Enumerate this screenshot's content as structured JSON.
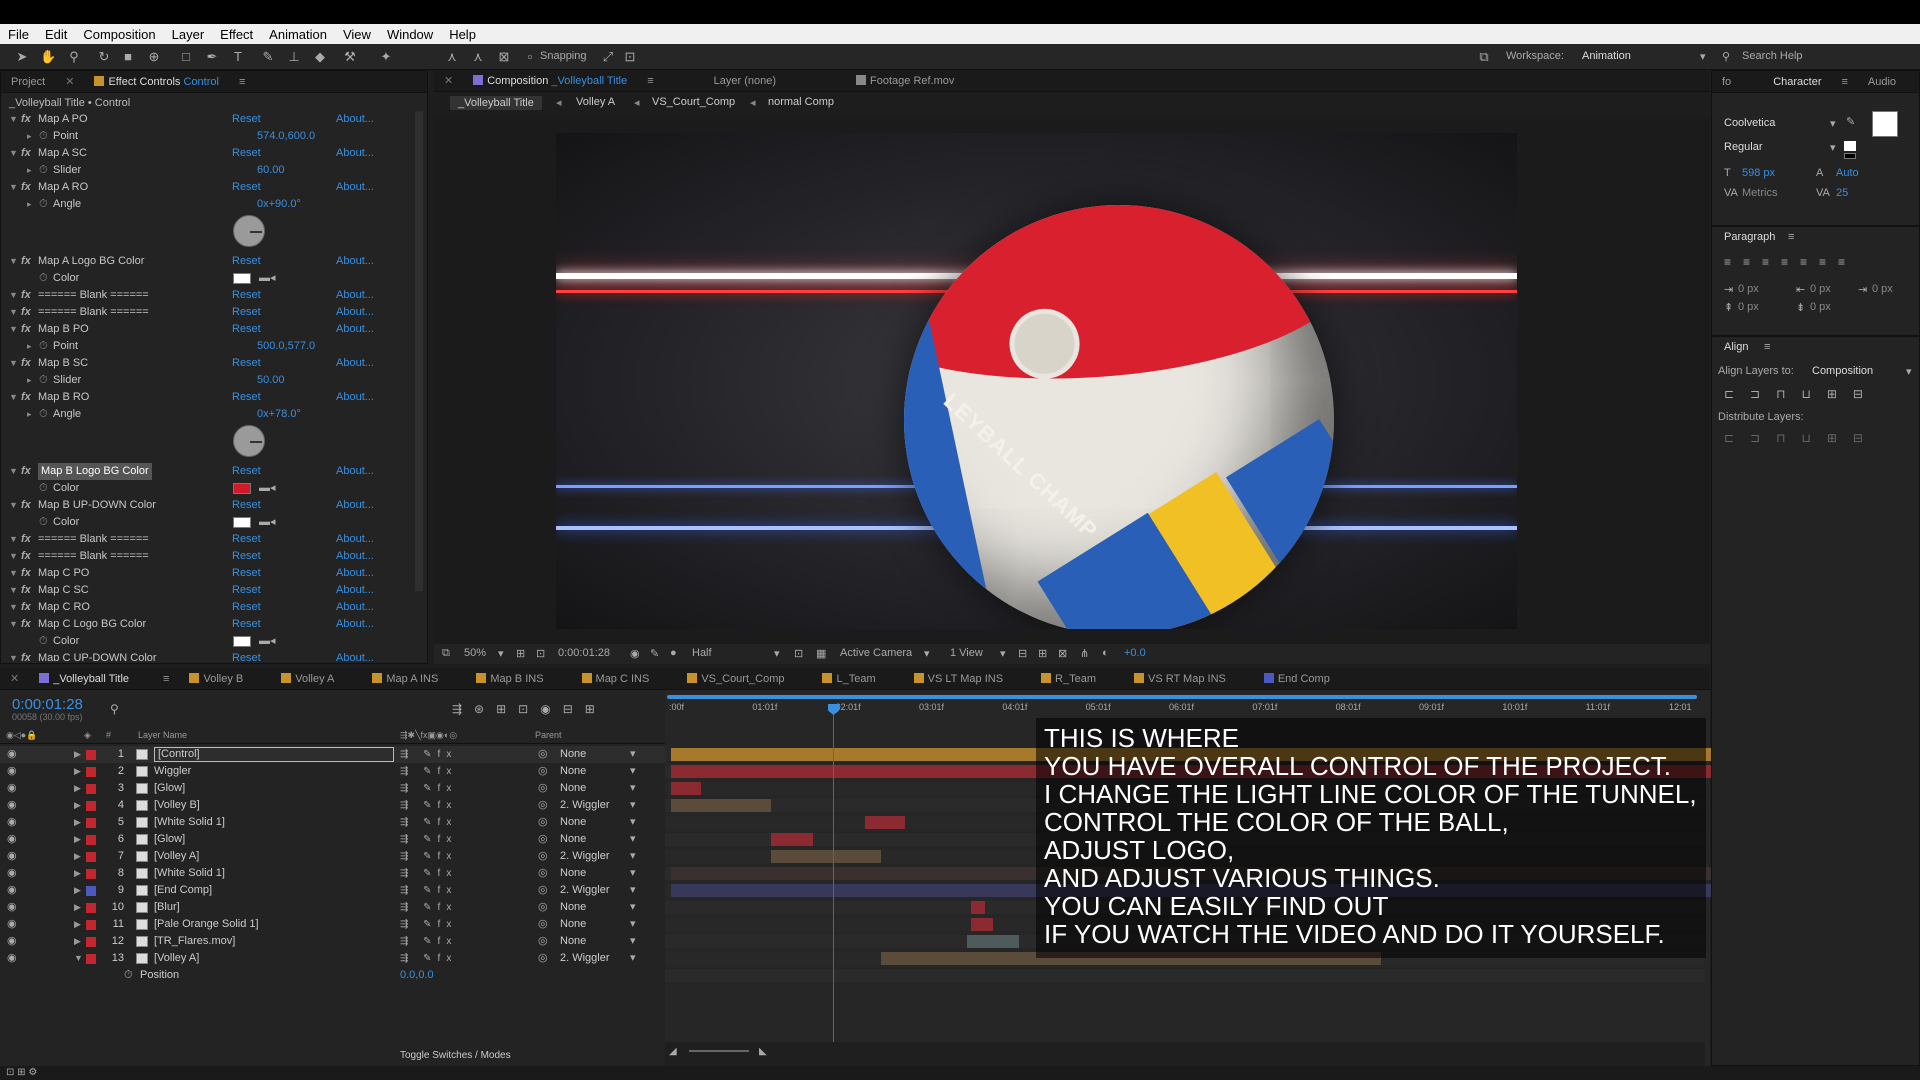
{
  "menu": [
    "File",
    "Edit",
    "Composition",
    "Layer",
    "Effect",
    "Animation",
    "View",
    "Window",
    "Help"
  ],
  "toolbar": {
    "snapping": "Snapping",
    "workspace_label": "Workspace:",
    "workspace_value": "Animation",
    "search": "Search Help"
  },
  "left_panel": {
    "tabs": [
      "Project",
      "Effect Controls",
      "Control"
    ],
    "breadcrumb": "_Volleyball Title • Control",
    "reset": "Reset",
    "about": "About...",
    "rows": [
      {
        "kind": "fx",
        "name": "Map A PO"
      },
      {
        "kind": "prop",
        "name": "Point",
        "value": "574.0,600.0"
      },
      {
        "kind": "fx",
        "name": "Map A SC"
      },
      {
        "kind": "prop",
        "name": "Slider",
        "value": "60.00"
      },
      {
        "kind": "fx",
        "name": "Map A RO"
      },
      {
        "kind": "prop",
        "name": "Angle",
        "value": "0x+90.0°"
      },
      {
        "kind": "dial"
      },
      {
        "kind": "fx",
        "name": "Map A Logo BG Color"
      },
      {
        "kind": "color",
        "name": "Color",
        "color": "#ffffff"
      },
      {
        "kind": "fx",
        "name": "====== Blank ======"
      },
      {
        "kind": "fx",
        "name": "====== Blank ======"
      },
      {
        "kind": "fx",
        "name": "Map B PO"
      },
      {
        "kind": "prop",
        "name": "Point",
        "value": "500.0,577.0"
      },
      {
        "kind": "fx",
        "name": "Map B SC"
      },
      {
        "kind": "prop",
        "name": "Slider",
        "value": "50.00"
      },
      {
        "kind": "fx",
        "name": "Map B RO"
      },
      {
        "kind": "prop",
        "name": "Angle",
        "value": "0x+78.0°"
      },
      {
        "kind": "dial"
      },
      {
        "kind": "fx",
        "name": "Map B Logo BG Color",
        "selected": true
      },
      {
        "kind": "color",
        "name": "Color",
        "color": "#d01a2a"
      },
      {
        "kind": "fx",
        "name": "Map B UP-DOWN Color"
      },
      {
        "kind": "color",
        "name": "Color",
        "color": "#ffffff"
      },
      {
        "kind": "fx",
        "name": "====== Blank ======"
      },
      {
        "kind": "fx",
        "name": "====== Blank ======"
      },
      {
        "kind": "fx",
        "name": "Map C PO"
      },
      {
        "kind": "fx",
        "name": "Map C SC"
      },
      {
        "kind": "fx",
        "name": "Map C RO"
      },
      {
        "kind": "fx",
        "name": "Map C Logo BG Color"
      },
      {
        "kind": "color",
        "name": "Color",
        "color": "#ffffff"
      },
      {
        "kind": "fx",
        "name": "Map C UP-DOWN Color"
      }
    ]
  },
  "viewer": {
    "tabs": [
      "Composition",
      "_Volleyball Title",
      "Layer (none)",
      "Footage Ref.mov"
    ],
    "breadcrumbs": [
      "_Volleyball Title",
      "Volley A",
      "VS_Court_Comp",
      "normal Comp"
    ],
    "ball_text": "LEYBALL CHAMP",
    "footer": {
      "zoom": "50%",
      "timecode": "0:00:01:28",
      "resolution": "Half",
      "camera": "Active Camera",
      "views": "1 View",
      "exposure": "+0.0"
    }
  },
  "timeline": {
    "tabs": [
      "_Volleyball Title",
      "Volley B",
      "Volley A",
      "Map A INS",
      "Map B INS",
      "Map C INS",
      "VS_Court_Comp",
      "L_Team",
      "VS LT Map INS",
      "R_Team",
      "VS RT Map INS",
      "End Comp"
    ],
    "timecode": "0:00:01:28",
    "fps": "00058 (30.00 fps)",
    "col_layer": "Layer Name",
    "col_parent": "Parent",
    "ruler": [
      ":00f",
      "01:01f",
      "02:01f",
      "03:01f",
      "04:01f",
      "05:01f",
      "06:01f",
      "07:01f",
      "08:01f",
      "09:01f",
      "10:01f",
      "11:01f",
      "12:01"
    ],
    "layers": [
      {
        "num": "1",
        "name": "[Control]",
        "parent": "None",
        "color": "#c4262f"
      },
      {
        "num": "2",
        "name": "Wiggler",
        "parent": "None",
        "color": "#c4262f"
      },
      {
        "num": "3",
        "name": "[Glow]",
        "parent": "None",
        "color": "#c4262f"
      },
      {
        "num": "4",
        "name": "[Volley B]",
        "parent": "2. Wiggler",
        "color": "#c4262f"
      },
      {
        "num": "5",
        "name": "[White Solid 1]",
        "parent": "None",
        "color": "#c4262f"
      },
      {
        "num": "6",
        "name": "[Glow]",
        "parent": "None",
        "color": "#c4262f"
      },
      {
        "num": "7",
        "name": "[Volley A]",
        "parent": "2. Wiggler",
        "color": "#c4262f"
      },
      {
        "num": "8",
        "name": "[White Solid 1]",
        "parent": "None",
        "color": "#c4262f"
      },
      {
        "num": "9",
        "name": "[End Comp]",
        "parent": "2. Wiggler",
        "color": "#4a5ac0"
      },
      {
        "num": "10",
        "name": "[Blur]",
        "parent": "None",
        "color": "#c4262f"
      },
      {
        "num": "11",
        "name": "[Pale Orange Solid 1]",
        "parent": "None",
        "color": "#c4262f"
      },
      {
        "num": "12",
        "name": "[TR_Flares.mov]",
        "parent": "None",
        "color": "#c4262f"
      },
      {
        "num": "13",
        "name": "[Volley A]",
        "parent": "2. Wiggler",
        "color": "#c4262f"
      }
    ],
    "sub_prop": {
      "name": "Position",
      "value": "0.0,0.0"
    },
    "toggle": "Toggle Switches / Modes"
  },
  "caption": [
    "THIS IS WHERE",
    "YOU HAVE OVERALL CONTROL OF THE PROJECT.",
    "I CHANGE THE LIGHT LINE COLOR OF THE TUNNEL,",
    "CONTROL THE COLOR OF THE BALL,",
    "ADJUST LOGO,",
    "AND ADJUST VARIOUS THINGS.",
    "YOU CAN EASILY FIND OUT",
    "IF YOU WATCH THE VIDEO AND DO IT YOURSELF."
  ],
  "character": {
    "tabs": [
      "fo",
      "Character",
      "Audio"
    ],
    "font": "Coolvetica",
    "style": "Regular",
    "size": "598 px",
    "leading": "Auto",
    "kerning": "Metrics",
    "tracking": "25"
  },
  "paragraph": {
    "title": "Paragraph",
    "values": [
      "0 px",
      "0 px",
      "0 px",
      "0 px",
      "0 px"
    ]
  },
  "align": {
    "title": "Align",
    "align_to_label": "Align Layers to:",
    "align_to": "Composition",
    "distribute": "Distribute Layers:"
  }
}
